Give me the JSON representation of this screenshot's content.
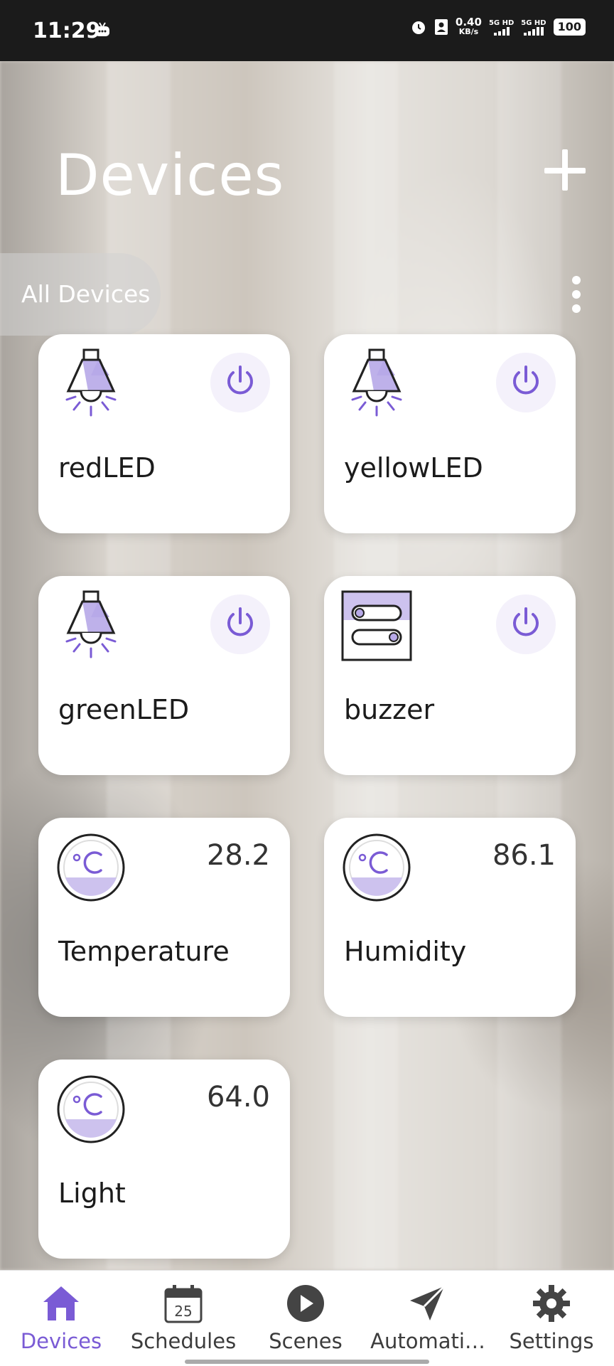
{
  "status_bar": {
    "time": "11:29",
    "net_speed": "0.40",
    "net_unit": "KB/s",
    "sim1": "5G HD",
    "sim2": "5G HD",
    "battery": "100"
  },
  "header": {
    "title": "Devices",
    "filter_label": "All Devices"
  },
  "colors": {
    "accent": "#7a5bd5",
    "power_bg": "#f4f1fb",
    "card_bg": "#ffffff"
  },
  "devices": [
    {
      "label": "redLED",
      "icon": "lamp-icon",
      "control": "power"
    },
    {
      "label": "yellowLED",
      "icon": "lamp-icon",
      "control": "power"
    },
    {
      "label": "greenLED",
      "icon": "lamp-icon",
      "control": "power"
    },
    {
      "label": "buzzer",
      "icon": "switch-icon",
      "control": "power"
    },
    {
      "label": "Temperature",
      "icon": "celsius-sensor-icon",
      "value": "28.2"
    },
    {
      "label": "Humidity",
      "icon": "celsius-sensor-icon",
      "value": "86.1"
    },
    {
      "label": "Light",
      "icon": "celsius-sensor-icon",
      "value": "64.0"
    }
  ],
  "nav": [
    {
      "label": "Devices",
      "icon": "home-icon",
      "active": true
    },
    {
      "label": "Schedules",
      "icon": "calendar-icon",
      "badge": "25"
    },
    {
      "label": "Scenes",
      "icon": "play-icon"
    },
    {
      "label": "Automati…",
      "icon": "send-icon"
    },
    {
      "label": "Settings",
      "icon": "gear-icon"
    }
  ]
}
